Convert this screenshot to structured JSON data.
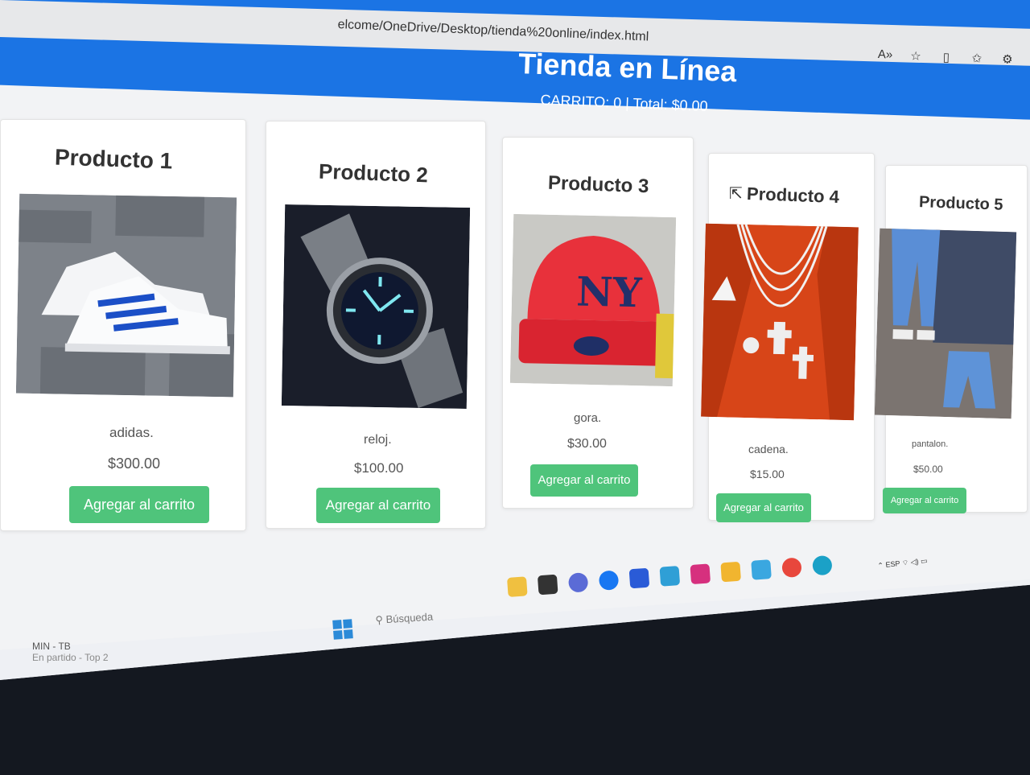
{
  "browser": {
    "url": "elcome/OneDrive/Desktop/tienda%20online/index.html"
  },
  "header": {
    "title": "Tienda en Línea",
    "cart": "CARRITO: 0 | Total: $0.00"
  },
  "products": [
    {
      "name": "Producto 1",
      "desc": "adidas.",
      "price": "$300.00",
      "button": "Agregar al carrito",
      "image": "sneaker-image"
    },
    {
      "name": "Producto 2",
      "desc": "reloj.",
      "price": "$100.00",
      "button": "Agregar al carrito",
      "image": "watch-image"
    },
    {
      "name": "Producto 3",
      "desc": "gora.",
      "price": "$30.00",
      "button": "Agregar al carrito",
      "image": "cap-image"
    },
    {
      "name": "Producto 4",
      "desc": "cadena.",
      "price": "$15.00",
      "button": "Agregar al carrito",
      "image": "chain-image"
    },
    {
      "name": "Producto 5",
      "desc": "pantalon.",
      "price": "$50.00",
      "button": "Agregar al carrito",
      "image": "jeans-image"
    }
  ],
  "taskbar": {
    "widget_line1": "MIN - TB",
    "widget_line2": "En partido - Top 2",
    "search_placeholder": "Búsqueda",
    "tray_lang": "ESP"
  },
  "colors": {
    "header_blue": "#1b74e4",
    "button_green": "#4fc47b"
  }
}
